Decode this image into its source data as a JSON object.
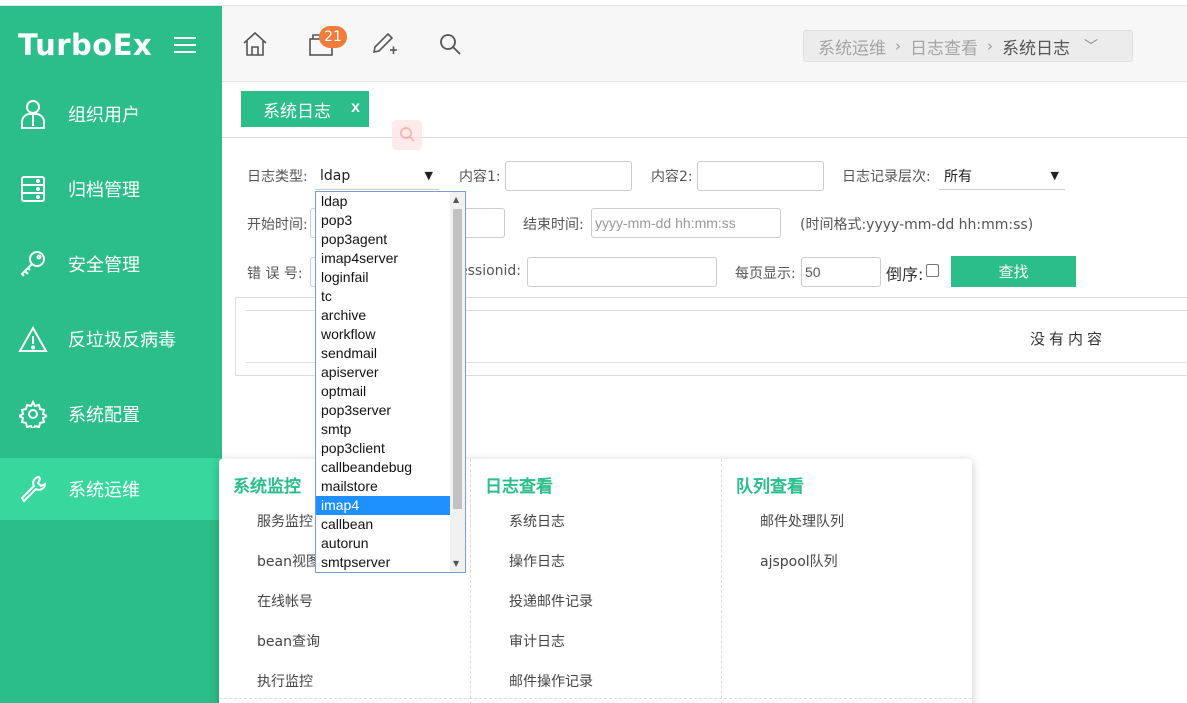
{
  "brand": "TurboEx",
  "sidebar": {
    "items": [
      {
        "label": "组织用户",
        "icon": "user-icon"
      },
      {
        "label": "归档管理",
        "icon": "server-icon"
      },
      {
        "label": "安全管理",
        "icon": "key-icon"
      },
      {
        "label": "反垃圾反病毒",
        "icon": "warning-icon"
      },
      {
        "label": "系统配置",
        "icon": "gear-icon"
      },
      {
        "label": "系统运维",
        "icon": "wrench-icon",
        "active": true
      }
    ]
  },
  "topbar": {
    "badge_count": "21",
    "breadcrumb": [
      "系统运维",
      "日志查看",
      "系统日志"
    ]
  },
  "tab": {
    "label": "系统日志",
    "close": "x"
  },
  "form": {
    "log_type_label": "日志类型:",
    "log_type_value": "ldap",
    "content1_label": "内容1:",
    "content2_label": "内容2:",
    "level_label": "日志记录层次:",
    "level_value": "所有",
    "start_time_label": "开始时间:",
    "end_time_label": "结束时间:",
    "end_time_placeholder": "yyyy-mm-dd hh:mm:ss",
    "time_format_hint": "(时间格式:yyyy-mm-dd hh:mm:ss)",
    "error_no_label": "错 误 号:",
    "sessionid_label": "essionid:",
    "page_size_label": "每页显示:",
    "page_size_value": "50",
    "reverse_label": "倒序:",
    "search_button": "查找"
  },
  "results": {
    "empty_text": "没有内容"
  },
  "dropdown": {
    "options": [
      "ldap",
      "pop3",
      "pop3agent",
      "imap4server",
      "loginfail",
      "tc",
      "archive",
      "workflow",
      "sendmail",
      "apiserver",
      "optmail",
      "pop3server",
      "smtp",
      "pop3client",
      "callbeandebug",
      "mailstore",
      "imap4",
      "callbean",
      "autorun",
      "smtpserver"
    ],
    "selected": "imap4"
  },
  "mega_menu": {
    "columns": [
      {
        "title": "系统监控",
        "items": [
          "服务监控",
          "bean视图",
          "在线帐号",
          "bean查询",
          "执行监控"
        ]
      },
      {
        "title": "日志查看",
        "items": [
          "系统日志",
          "操作日志",
          "投递邮件记录",
          "审计日志",
          "邮件操作记录"
        ]
      },
      {
        "title": "队列查看",
        "items": [
          "邮件处理队列",
          "ajspool队列"
        ]
      }
    ]
  }
}
